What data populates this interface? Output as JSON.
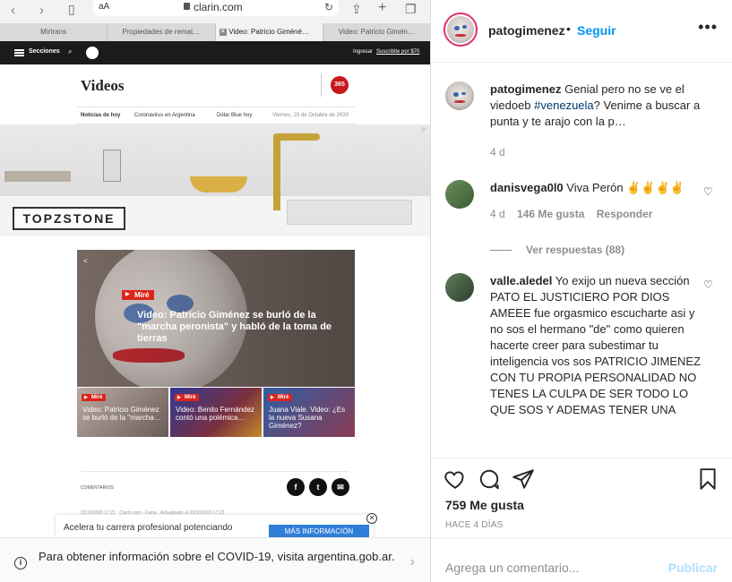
{
  "browser": {
    "text_size_label": "aA",
    "url": "clarin.com",
    "tabs": [
      {
        "label": "Mirtrans"
      },
      {
        "label": "Propiedades de remat…"
      },
      {
        "label": "Video: Patricio Giméné…"
      },
      {
        "label": "Video: Patricio Gimén…"
      }
    ]
  },
  "clarin": {
    "sections_label": "Secciones",
    "login_label": "Ingresar",
    "subscribe_label": "Suscribite por $70",
    "page_title": "Videos",
    "logo_365": "365",
    "subnav": {
      "item1": "Noticias de hoy",
      "item2": "Coronavirus en Argentina",
      "item3": "Dólar Blue hoy",
      "date": "Viernes, 23 de Octubre de 2020"
    },
    "ad_brand": "TOPZSTONE",
    "main_video": {
      "badge": "Miré",
      "headline": "Video: Patricio Giménez se burló de la \"marcha peronista\" y habló de la toma de tierras"
    },
    "thumbs": [
      {
        "badge": "Miré",
        "caption": "Video: Patricio Giménez se burló de la \"marcha…"
      },
      {
        "badge": "Miré",
        "caption": "Video: Benito Fernández contó una polémica…"
      },
      {
        "badge": "Miré",
        "caption": "Juana Viale. Video: ¿Es la nueva Susana Giménez?"
      }
    ],
    "comments_label": "COMENTARIOS",
    "meta_small": "23/10/2020 17:21 · Clarín.com · Fama · Actualizado al 23/10/2020 17:22",
    "toast_text": "Acelera tu carrera profesional potenciando",
    "toast_button": "MÁS INFORMACIÓN",
    "covid_text": "Para obtener información sobre el COVID-19, visita argentina.gob.ar."
  },
  "instagram": {
    "username": "patogimenez",
    "follow_label": "Seguir",
    "comments": [
      {
        "user": "patogimenez",
        "text_before": " Genial pero no se ve el viedoeb ",
        "hashtag": "#venezuela",
        "text_after": "? Venime a buscar a punta y te arajo con la p…",
        "time": "4 d"
      },
      {
        "user": "danisvega0l0",
        "text": " Viva Perón ✌✌✌✌",
        "time": "4 d",
        "likes": "146 Me gusta",
        "reply": "Responder"
      },
      {
        "user": "valle.aledel",
        "text": " Yo exijo un nueva sección PATO EL JUSTICIERO POR DIOS AMEEE fue orgasmico escucharte asi y no sos el hermano \"de\" como quieren hacerte creer para subestimar tu inteligencia vos sos PATRICIO JIMENEZ CON TU PROPIA PERSONALIDAD NO TENES LA CULPA DE SER TODO LO QUE SOS Y ADEMAS TENER UNA"
      }
    ],
    "view_replies": "Ver respuestas (88)",
    "likes_count": "759 Me gusta",
    "posted_ago": "HACE 4 DÍAS",
    "add_comment_placeholder": "Agrega un comentario...",
    "publish_label": "Publicar"
  }
}
